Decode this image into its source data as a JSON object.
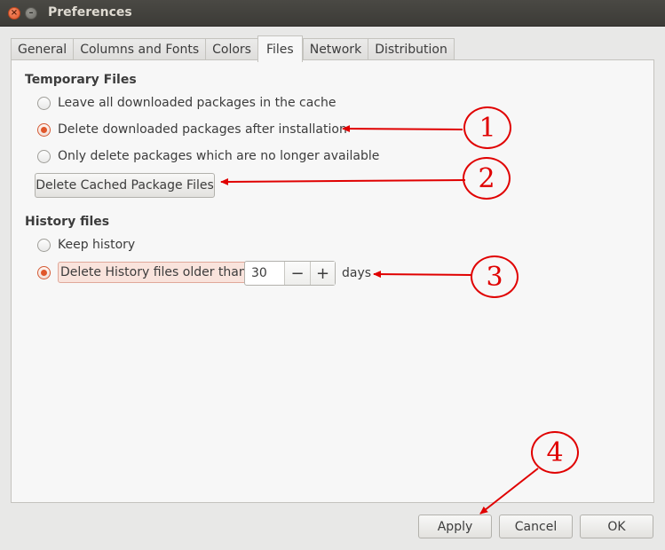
{
  "window": {
    "title": "Preferences",
    "close_glyph": "×",
    "minimize_glyph": "–"
  },
  "tabs": [
    {
      "label": "General"
    },
    {
      "label": "Columns and Fonts"
    },
    {
      "label": "Colors"
    },
    {
      "label": "Files",
      "active": true
    },
    {
      "label": "Network"
    },
    {
      "label": "Distribution"
    }
  ],
  "temporary_files": {
    "heading": "Temporary Files",
    "option_keep": "Leave all downloaded packages in the cache",
    "option_delete_after_install": "Delete downloaded packages after installation",
    "option_delete_unavailable": "Only delete packages which are no longer available",
    "selected": "option_delete_after_install",
    "delete_cached_button": "Delete Cached Package Files"
  },
  "history_files": {
    "heading": "History files",
    "option_keep": "Keep history",
    "option_delete_older": "Delete History files older than:",
    "selected": "option_delete_older",
    "days_value": "30",
    "decrement_glyph": "−",
    "increment_glyph": "+",
    "days_unit": "days"
  },
  "footer": {
    "apply": "Apply",
    "cancel": "Cancel",
    "ok": "OK"
  },
  "annotations": [
    "1",
    "2",
    "3",
    "4"
  ],
  "colors": {
    "annotation_red": "#e00000",
    "radio_accent": "#e0572b",
    "titlebar": "#3c3b37"
  }
}
